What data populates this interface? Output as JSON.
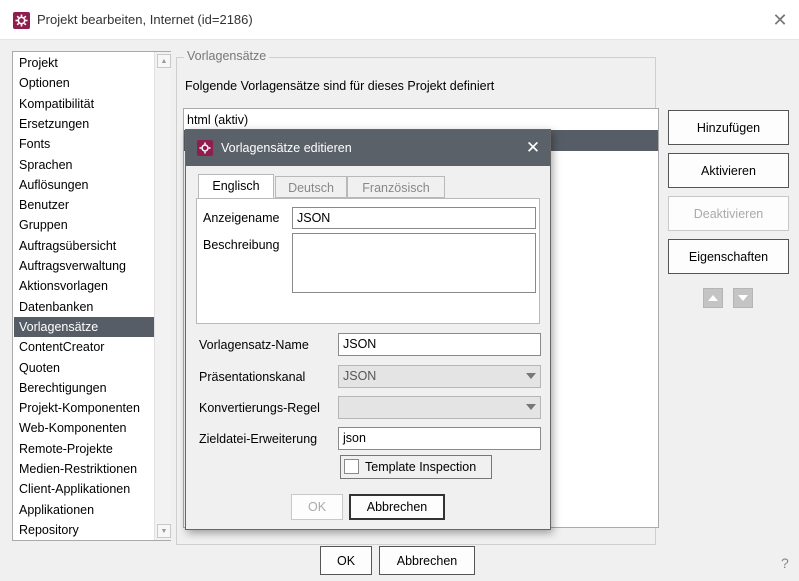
{
  "window": {
    "title": "Projekt bearbeiten, Internet (id=2186)",
    "close_symbol": "✕",
    "app_icon": "firstspirit-gear-icon",
    "help_symbol": "?"
  },
  "nav": {
    "items": [
      "Projekt",
      "Optionen",
      "Kompatibilität",
      "Ersetzungen",
      "Fonts",
      "Sprachen",
      "Auflösungen",
      "Benutzer",
      "Gruppen",
      "Auftragsübersicht",
      "Auftragsverwaltung",
      "Aktionsvorlagen",
      "Datenbanken",
      "Vorlagensätze",
      "ContentCreator",
      "Quoten",
      "Berechtigungen",
      "Projekt-Komponenten",
      "Web-Komponenten",
      "Remote-Projekte",
      "Medien-Restriktionen",
      "Client-Applikationen",
      "Applikationen",
      "Repository"
    ],
    "selected_index": 13
  },
  "main": {
    "group_label": "Vorlagensätze",
    "description": "Folgende Vorlagensätze sind für dieses Projekt definiert",
    "list": [
      "html (aktiv)",
      ""
    ],
    "selected_row": 1
  },
  "side_buttons": {
    "add": "Hinzufügen",
    "activate": "Aktivieren",
    "deactivate": "Deaktivieren",
    "properties": "Eigenschaften"
  },
  "bottom_buttons": {
    "ok": "OK",
    "cancel": "Abbrechen"
  },
  "dialog": {
    "title": "Vorlagensätze editieren",
    "close_symbol": "✕",
    "tabs": [
      "Englisch",
      "Deutsch",
      "Französisch"
    ],
    "active_tab": 0,
    "display_name_label": "Anzeigename",
    "display_name_value": "JSON",
    "description_label": "Beschreibung",
    "description_value": "",
    "name_label": "Vorlagensatz-Name",
    "name_value": "JSON",
    "channel_label": "Präsentationskanal",
    "channel_value": "JSON",
    "conversion_label": "Konvertierungs-Regel",
    "conversion_value": "",
    "extension_label": "Zieldatei-Erweiterung",
    "extension_value": "json",
    "template_inspection_label": "Template Inspection",
    "template_inspection_checked": false,
    "ok": "OK",
    "cancel": "Abbrechen"
  },
  "colors": {
    "selection": "#565d66",
    "dialog_titlebar": "#5b6168",
    "brand_icon": "#8f1d50"
  }
}
